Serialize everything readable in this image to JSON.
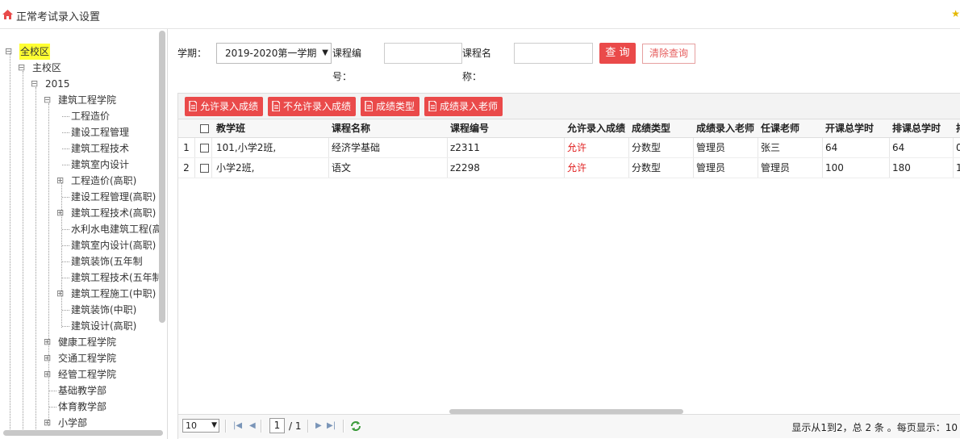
{
  "header": {
    "title": "正常考试录入设置"
  },
  "tree": {
    "nodes": [
      {
        "label": "全校区",
        "selected": true
      },
      {
        "label": "主校区"
      },
      {
        "label": "2015"
      },
      {
        "label": "建筑工程学院"
      },
      {
        "label": "工程造价"
      },
      {
        "label": "建设工程管理"
      },
      {
        "label": "建筑工程技术"
      },
      {
        "label": "建筑室内设计"
      },
      {
        "label": "工程造价(高职)"
      },
      {
        "label": "建设工程管理(高职)"
      },
      {
        "label": "建筑工程技术(高职)"
      },
      {
        "label": "水利水电建筑工程(高"
      },
      {
        "label": "建筑室内设计(高职)"
      },
      {
        "label": "建筑装饰(五年制"
      },
      {
        "label": "建筑工程技术(五年制"
      },
      {
        "label": "建筑工程施工(中职)"
      },
      {
        "label": "建筑装饰(中职)"
      },
      {
        "label": "建筑设计(高职)"
      },
      {
        "label": "健康工程学院"
      },
      {
        "label": "交通工程学院"
      },
      {
        "label": "经管工程学院"
      },
      {
        "label": "基础教学部"
      },
      {
        "label": "体育教学部"
      },
      {
        "label": "小学部"
      }
    ]
  },
  "search": {
    "term_label": "学期：",
    "term_value": "2019-2020第一学期",
    "code_label_1": "课程编",
    "code_label_2": "号：",
    "name_label_1": "课程名",
    "name_label_2": "称：",
    "query_button": "查 询",
    "clear_button": "清除查询"
  },
  "toolbar": {
    "allow": "允许录入成绩",
    "disallow": "不允许录入成绩",
    "score_type": "成绩类型",
    "score_teacher": "成绩录入老师"
  },
  "table": {
    "columns": [
      "教学班",
      "课程名称",
      "课程编号",
      "允许录入成绩",
      "成绩类型",
      "成绩录入老师",
      "任课老师",
      "开课总学时",
      "排课总学时",
      "排"
    ],
    "rows": [
      {
        "num": "1",
        "class": "101,小学2班,",
        "course": "经济学基础",
        "code": "z2311",
        "allow": "允许",
        "type": "分数型",
        "entry_teacher": "管理员",
        "teacher": "张三",
        "total_hours": "64",
        "sched_hours": "64",
        "extra": "0"
      },
      {
        "num": "2",
        "class": "小学2班,",
        "course": "语文",
        "code": "z2298",
        "allow": "允许",
        "type": "分数型",
        "entry_teacher": "管理员",
        "teacher": "管理员",
        "total_hours": "100",
        "sched_hours": "180",
        "extra": "1"
      }
    ]
  },
  "pager": {
    "page_size": "10",
    "current_page": "1",
    "total_pages": "/ 1",
    "info": "显示从1到2，总 2 条 。每页显示：10"
  },
  "colors": {
    "accent": "#ea4a4a",
    "highlight": "#ffff33",
    "allow_text": "#e02020"
  }
}
